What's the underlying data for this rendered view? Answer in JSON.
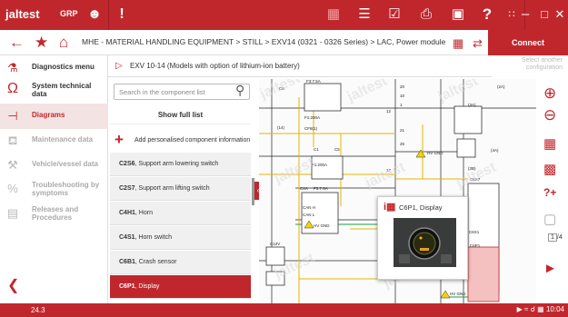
{
  "topbar": {
    "brand": "jaltest",
    "brand_sub": "BY COJALI",
    "grp": "GRP",
    "icons": [
      "people-group-icon",
      "alert-icon",
      "document-icon",
      "list-icon",
      "checklist-icon",
      "printer-icon",
      "camera-icon",
      "help-icon",
      "grid-icon",
      "minimize-icon",
      "maximize-icon",
      "close-icon"
    ]
  },
  "navbar": {
    "breadcrumb": "MHE - MATERIAL HANDLING EQUIPMENT  >  STILL  >  EXV14 (0321 - 0326 Series)  >  LAC, Power module",
    "connect_label": "Connect",
    "select_another": "Select another configuration"
  },
  "leftnav": {
    "items": [
      {
        "label": "Diagnostics menu",
        "icon": "diagnostics-icon",
        "enabled": true
      },
      {
        "label": "System technical data",
        "icon": "ohm-icon",
        "enabled": true
      },
      {
        "label": "Diagrams",
        "icon": "diagram-icon",
        "enabled": true,
        "active": true
      },
      {
        "label": "Maintenance data",
        "icon": "oil-can-icon",
        "enabled": false
      },
      {
        "label": "Vehicle/vessel data",
        "icon": "wrench-icon",
        "enabled": false
      },
      {
        "label": "Troubleshooting by symptoms",
        "icon": "percent-icon",
        "enabled": false
      },
      {
        "label": "Releases and Procedures",
        "icon": "releases-icon",
        "enabled": false
      }
    ]
  },
  "diagram_title": "EXV 10-14 (Models with option of lithium-ion battery)",
  "component_panel": {
    "search_placeholder": "Search in the component list",
    "show_full_list": "Show full list",
    "add_component": "Add personalised component information",
    "components": [
      {
        "code": "C2S6",
        "name": ", Support arm lowering switch"
      },
      {
        "code": "C2S7",
        "name": ", Support arm lifting switch"
      },
      {
        "code": "C4H1",
        "name": ", Horn"
      },
      {
        "code": "C4S1",
        "name": ", Horn switch"
      },
      {
        "code": "C6B1",
        "name": ", Crash sensor"
      },
      {
        "code": "C6P1",
        "name": ", Display",
        "selected": true
      }
    ]
  },
  "popup": {
    "title": "C6P1, Display"
  },
  "diagram_labels": {
    "f1": "F1:200A",
    "f2": "F1:200A",
    "f3": "F3:7.5A",
    "f4": "F3:7.5A",
    "c1": "C6",
    "c2": "C1",
    "c3": "C5",
    "cfb": "CF8(1)",
    "c14": "(14)",
    "c4a": "C4A",
    "hv1": "HV GND",
    "hv2": "HV GND",
    "hv3": "HV GND",
    "can_h": "CAN H",
    "can_l": "CAN L",
    "c12v": "C12V",
    "c6p1": "C6P1",
    "c6x1": "C6X1",
    "c6x7": "C6X7",
    "n3a": "(3A)",
    "n4a": "(4A)",
    "n2a": "(2A)",
    "n2b": "(2B)",
    "n20": "20",
    "n10": "10",
    "n21": "21",
    "n25": "25",
    "n1": "1",
    "n17": "17",
    "n12": "12"
  },
  "page_indicator": {
    "current": "1",
    "total": "/4"
  },
  "status": {
    "version": "24.3",
    "time": "10:04"
  }
}
